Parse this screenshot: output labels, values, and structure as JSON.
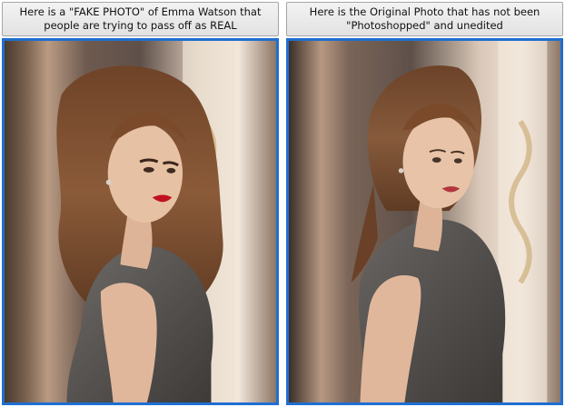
{
  "panels": [
    {
      "caption": "Here is a \"FAKE PHOTO\" of Emma Watson that people are trying to pass off as REAL",
      "variant": "fake"
    },
    {
      "caption": "Here is the Original Photo that has not been \"Photoshopped\" and unedited",
      "variant": "original"
    }
  ],
  "colors": {
    "frame_border": "#1f6fd1",
    "caption_bg": "#e8e8e8",
    "caption_border": "#a6a6a6",
    "fake_lips": "#c1121f",
    "original_lips": "#b2373f",
    "hair": "#6b3f21",
    "dress": "#5a5755",
    "skin": "#e7c1a4"
  }
}
